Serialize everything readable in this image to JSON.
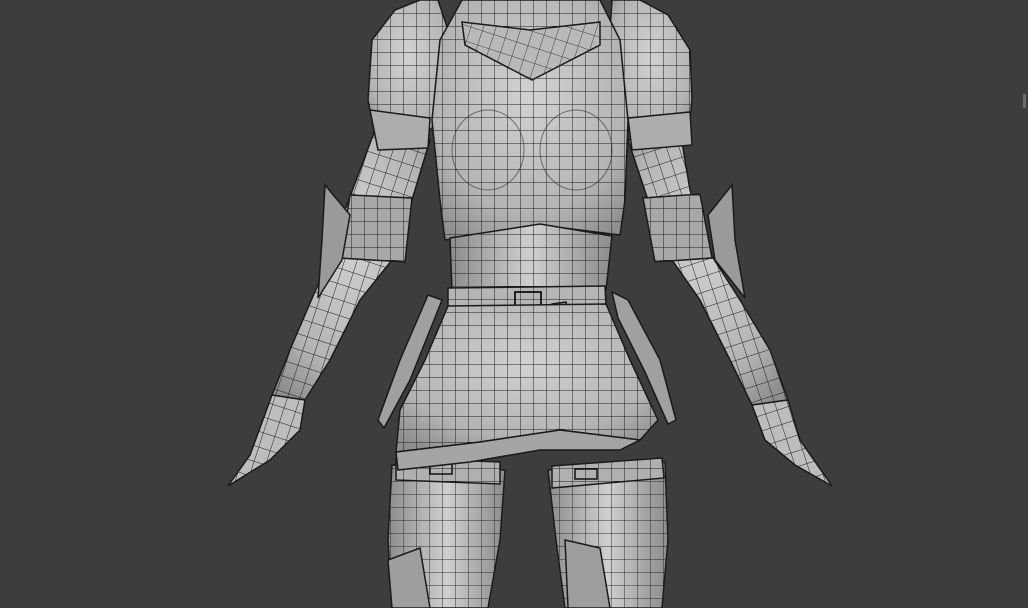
{
  "viewport": {
    "background": "#3d3d3d",
    "shading": "solid-with-wireframe",
    "model_fill": "#bdbdbd",
    "wire_color": "#1c1c1c"
  }
}
